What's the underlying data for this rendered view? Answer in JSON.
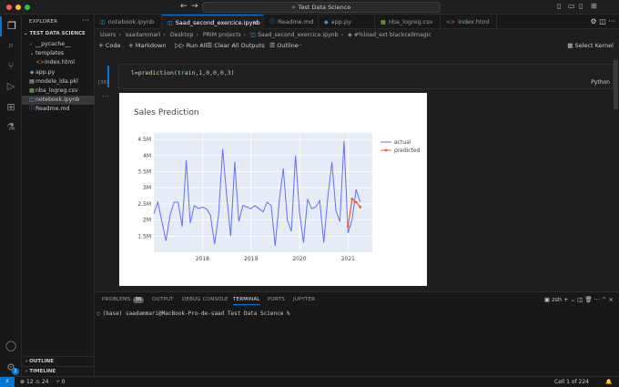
{
  "titlebar": {
    "command_center": "Test Data Science",
    "back": "←",
    "forward": "→"
  },
  "colors": {
    "accent": "#0078d4",
    "close": "#ff5f57",
    "minimize": "#febc2e",
    "zoom": "#28c840",
    "actual_series": "#636efa",
    "predicted_series": "#ef553b"
  },
  "activitybar": {
    "icons": [
      "explorer-icon",
      "search-icon",
      "source-control-icon",
      "run-debug-icon",
      "extensions-icon",
      "testing-icon",
      "account-icon",
      "manage-gear-icon"
    ],
    "badge": "1"
  },
  "explorer": {
    "header": "EXPLORER",
    "root": "TEST DATA SCIENCE",
    "items": [
      {
        "label": "__pycache__",
        "kind": "folder",
        "open": false,
        "indent": 1
      },
      {
        "label": "templates",
        "kind": "folder",
        "open": true,
        "indent": 1
      },
      {
        "label": "index.html",
        "kind": "html",
        "indent": 2
      },
      {
        "label": "app.py",
        "kind": "py",
        "indent": 1
      },
      {
        "label": "modele_lda.pkl",
        "kind": "pkl",
        "indent": 1
      },
      {
        "label": "nba_logreg.csv",
        "kind": "csv",
        "indent": 1
      },
      {
        "label": "notebook.ipynb",
        "kind": "ipynb",
        "indent": 1,
        "selected": true
      },
      {
        "label": "Readme.md",
        "kind": "md",
        "indent": 1
      }
    ],
    "outline": "OUTLINE",
    "timeline": "TIMELINE"
  },
  "tabs": [
    {
      "label": "notebook.ipynb",
      "icon": "notebook-icon",
      "active": false
    },
    {
      "label": "Saad_second_exercice.ipynb",
      "icon": "notebook-icon",
      "active": true
    },
    {
      "label": "Readme.md",
      "icon": "info-icon",
      "active": false
    },
    {
      "label": "app.py",
      "icon": "python-icon",
      "active": false
    },
    {
      "label": "nba_logreg.csv",
      "icon": "csv-icon",
      "active": false
    },
    {
      "label": "index.html",
      "icon": "html-icon",
      "active": false
    }
  ],
  "breadcrumb": [
    "Users",
    "saadammari",
    "Desktop",
    "PRIM projects",
    "Saad_second_exercice.ipynb",
    "#%load_ext blackcellmagic"
  ],
  "nbtoolbar": {
    "code": "Code",
    "markdown": "Markdown",
    "run_all": "Run All",
    "clear_outputs": "Clear All Outputs",
    "outline": "Outline",
    "kernel": "Select Kernel"
  },
  "cell": {
    "code_assign": "l=",
    "code_fn": "prediction",
    "code_open": "(",
    "code_var": "train",
    "code_args": ",1,0,0,0,3",
    "code_close": ")",
    "exec_count": "[39]",
    "language": "Python",
    "more": "..."
  },
  "chart_data": {
    "type": "line",
    "title": "Sales Prediction",
    "xlabel": "",
    "ylabel": "",
    "x_ticks": [
      "2018",
      "2019",
      "2020",
      "2021"
    ],
    "y_ticks": [
      "1.5M",
      "2M",
      "2.5M",
      "3M",
      "3.5M",
      "4M",
      "4.5M"
    ],
    "ylim": [
      1000000,
      4700000
    ],
    "xlim": [
      2017.0,
      2021.5
    ],
    "grid": true,
    "legend_position": "top-right",
    "series": [
      {
        "name": "actual",
        "x": [
          2017.0,
          2017.083,
          2017.167,
          2017.25,
          2017.333,
          2017.417,
          2017.5,
          2017.583,
          2017.667,
          2017.75,
          2017.833,
          2017.917,
          2018.0,
          2018.083,
          2018.167,
          2018.25,
          2018.333,
          2018.417,
          2018.5,
          2018.583,
          2018.667,
          2018.75,
          2018.833,
          2018.917,
          2019.0,
          2019.083,
          2019.167,
          2019.25,
          2019.333,
          2019.417,
          2019.5,
          2019.583,
          2019.667,
          2019.75,
          2019.833,
          2019.917,
          2020.0,
          2020.083,
          2020.167,
          2020.25,
          2020.333,
          2020.417,
          2020.5,
          2020.583,
          2020.667,
          2020.75,
          2020.833,
          2020.917,
          2021.0,
          2021.083,
          2021.167,
          2021.25
        ],
        "y": [
          2200000,
          2550000,
          1950000,
          1350000,
          2150000,
          2550000,
          2550000,
          1800000,
          3850000,
          1900000,
          2450000,
          2350000,
          2400000,
          2350000,
          2150000,
          1250000,
          2150000,
          4200000,
          2750000,
          1500000,
          3800000,
          1950000,
          2450000,
          2400000,
          2350000,
          2450000,
          2350000,
          2250000,
          2550000,
          2450000,
          1200000,
          2600000,
          3600000,
          2000000,
          1650000,
          4000000,
          2250000,
          1300000,
          2650000,
          2350000,
          2400000,
          2600000,
          1300000,
          2700000,
          3800000,
          2300000,
          1950000,
          4450000,
          1600000,
          2000000,
          2950000,
          2550000
        ]
      },
      {
        "name": "predicted",
        "x": [
          2021.0,
          2021.083,
          2021.167,
          2021.25
        ],
        "y": [
          1800000,
          2650000,
          2550000,
          2400000
        ]
      }
    ]
  },
  "panel": {
    "tabs": [
      {
        "label": "PROBLEMS",
        "badge": "36",
        "active": false
      },
      {
        "label": "OUTPUT",
        "active": false
      },
      {
        "label": "DEBUG CONSOLE",
        "active": false
      },
      {
        "label": "TERMINAL",
        "active": true
      },
      {
        "label": "PORTS",
        "active": false
      },
      {
        "label": "JUPYTER",
        "active": false
      }
    ],
    "shell": "zsh",
    "terminal_prompt": "(base) saadammari@MacBook-Pro-de-saad Test Data Science %"
  },
  "statusbar": {
    "errors": "12",
    "warnings": "24",
    "ports": "0",
    "cell_position": "Cell 1 of 224"
  }
}
